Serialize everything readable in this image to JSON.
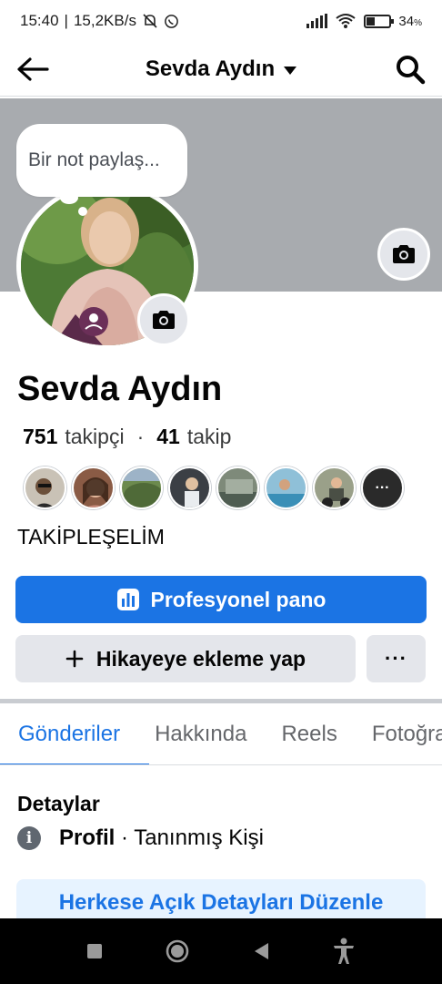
{
  "status_bar": {
    "time": "15:40",
    "speed": "15,2KB/s",
    "battery_percent": "34",
    "battery_unit": "%",
    "battery_level": 0.34
  },
  "header": {
    "title": "Sevda Aydın",
    "back_icon": "back-arrow-icon",
    "search_icon": "search-icon"
  },
  "profile": {
    "note_placeholder": "Bir not paylaş...",
    "name": "Sevda Aydın",
    "followers_count": "751",
    "followers_label": "takipçi",
    "separator": "·",
    "following_count": "41",
    "following_label": "takip",
    "more_followers": "···",
    "bio": "TAKİPLEŞELİM"
  },
  "actions": {
    "professional_dashboard": "Profesyonel pano",
    "add_story": "Hikayeye ekleme yap",
    "more": "···"
  },
  "tabs": [
    {
      "label": "Gönderiler",
      "active": true
    },
    {
      "label": "Hakkında",
      "active": false
    },
    {
      "label": "Reels",
      "active": false
    },
    {
      "label": "Fotoğraflar",
      "active": false
    }
  ],
  "details": {
    "title": "Detaylar",
    "profile_label": "Profil",
    "profile_type": " · Tanınmış Kişi",
    "edit_button": "Herkese Açık Detayları Düzenle"
  },
  "colors": {
    "accent": "#1b74e4",
    "cover": "#a8abaf",
    "button_gray": "#e4e6eb"
  }
}
